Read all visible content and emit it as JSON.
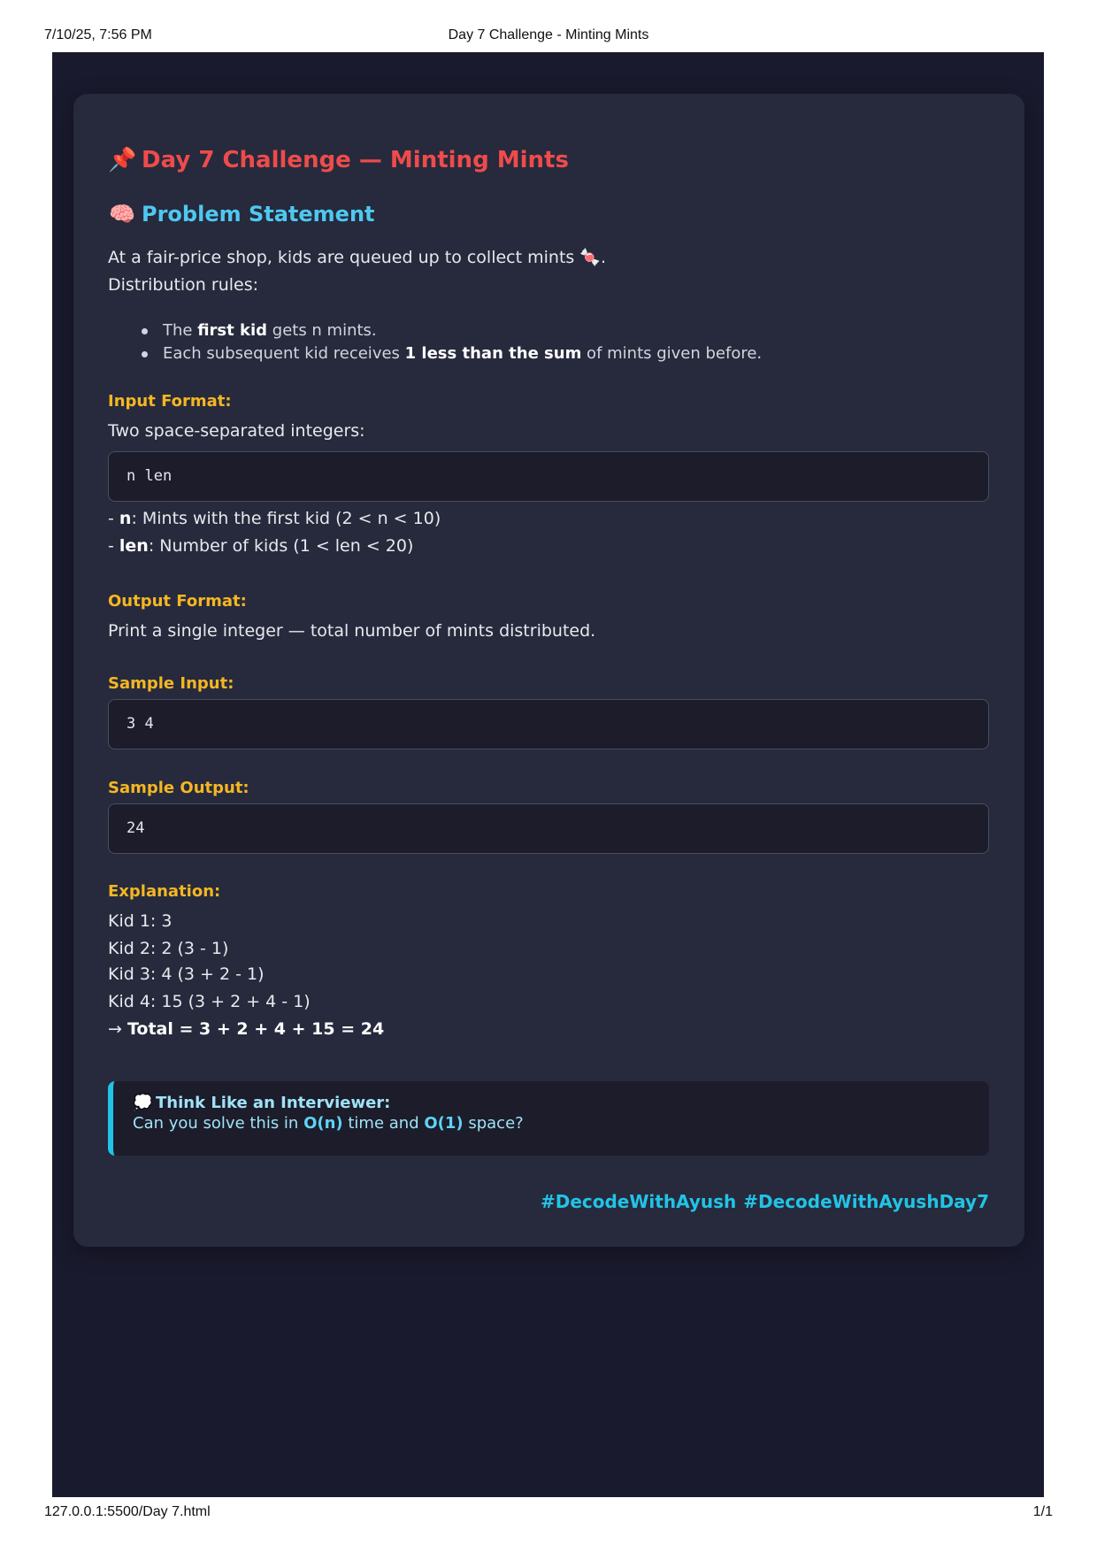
{
  "print": {
    "datetime": "7/10/25, 7:56 PM",
    "doc_title": "Day 7 Challenge - Minting Mints",
    "url": "127.0.0.1:5500/Day 7.html",
    "page": "1/1"
  },
  "title": {
    "icon": "📌",
    "text": "Day 7 Challenge — Minting Mints"
  },
  "problem": {
    "icon": "🧠",
    "heading": "Problem Statement",
    "intro_text": "At a fair-price shop, kids are queued up to collect mints",
    "intro_emoji": "🍬",
    "intro_end": ".",
    "rules_intro": "Distribution rules:",
    "rule1": {
      "pre": "The ",
      "bold": "first kid",
      "post": " gets n mints."
    },
    "rule2": {
      "pre": "Each subsequent kid receives ",
      "bold": "1 less than the sum",
      "post": " of mints given before."
    }
  },
  "input": {
    "label": "Input Format:",
    "desc": "Two space-separated integers:",
    "code": "n len",
    "n_name": "n",
    "n_desc": ": Mints with the first kid (2 < n < 10)",
    "len_name": "len",
    "len_desc": ": Number of kids (1 < len < 20)"
  },
  "output": {
    "label": "Output Format:",
    "desc": "Print a single integer — total number of mints distributed."
  },
  "sample_input": {
    "label": "Sample Input:",
    "code": "3 4"
  },
  "sample_output": {
    "label": "Sample Output:",
    "code": "24"
  },
  "explanation": {
    "label": "Explanation:",
    "lines": [
      "Kid 1: 3",
      "Kid 2: 2 (3 - 1)",
      "Kid 3: 4 (3 + 2 - 1)",
      "Kid 4: 15 (3 + 2 + 4 - 1)"
    ],
    "total_arrow": "→ ",
    "total": "Total = 3 + 2 + 4 + 15 = 24"
  },
  "tip": {
    "icon": "💭",
    "title": "Think Like an Interviewer:",
    "pre": "Can you solve this in ",
    "time": "O(n)",
    "mid": " time and ",
    "space": "O(1)",
    "post": " space?"
  },
  "hashtags": [
    "#DecodeWithAyush",
    "#DecodeWithAyushDay7"
  ]
}
